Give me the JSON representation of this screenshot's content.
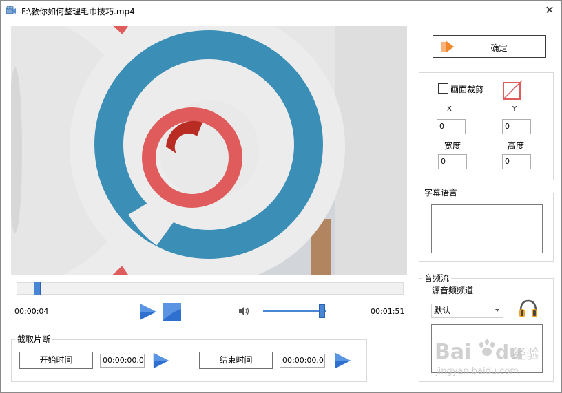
{
  "window": {
    "title": "F:\\教你如何整理毛巾技巧.mp4",
    "close_symbol": "✕"
  },
  "playback": {
    "current_time": "00:00:04",
    "total_time": "00:01:51",
    "seek_fraction": 0.043,
    "volume_fraction": 0.97
  },
  "confirm_label": "确定",
  "crop": {
    "checkbox_label": "画面裁剪",
    "checked": false,
    "x_label": "X",
    "y_label": "Y",
    "x_value": "0",
    "y_value": "0",
    "width_label": "宽度",
    "height_label": "高度",
    "width_value": "0",
    "height_value": "0"
  },
  "subtitle": {
    "title": "字幕语言"
  },
  "audio": {
    "title": "音频流",
    "channel_label": "源音频频道",
    "selected": "默认"
  },
  "clip": {
    "title": "截取片断",
    "start_label": "开始时间",
    "start_value": "00:00:00.00",
    "end_label": "结束时间",
    "end_value": "00:00:00.00"
  },
  "watermark": {
    "logo_text": "Bai du 经验",
    "url_text": "jingyan.baidu.com"
  },
  "colors": {
    "accent": "#4a86d6",
    "play_blue": "#2f6fd0",
    "ring_red": "#e05c5c",
    "ring_blue": "#3b8fb7"
  }
}
